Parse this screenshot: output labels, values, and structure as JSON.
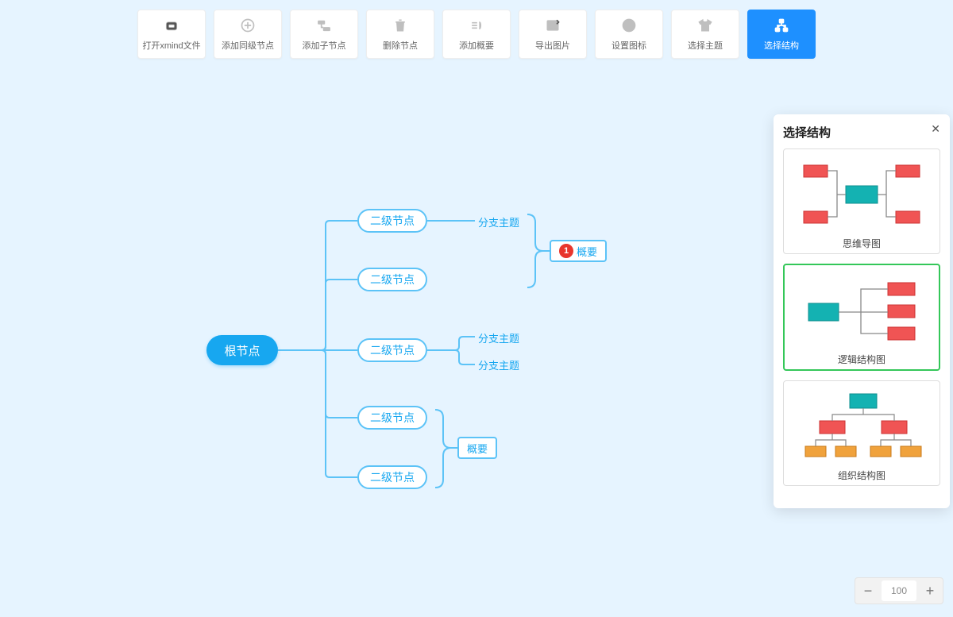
{
  "toolbar": {
    "buttons": [
      {
        "id": "open-xmind",
        "label": "打开xmind文件",
        "icon": "open"
      },
      {
        "id": "add-sibling",
        "label": "添加同级节点",
        "icon": "plus"
      },
      {
        "id": "add-child",
        "label": "添加子节点",
        "icon": "child"
      },
      {
        "id": "delete-node",
        "label": "删除节点",
        "icon": "trash"
      },
      {
        "id": "add-summary",
        "label": "添加概要",
        "icon": "summary"
      },
      {
        "id": "export-image",
        "label": "导出图片",
        "icon": "image"
      },
      {
        "id": "set-icon",
        "label": "设置图标",
        "icon": "smile"
      },
      {
        "id": "choose-theme",
        "label": "选择主题",
        "icon": "shirt"
      },
      {
        "id": "choose-structure",
        "label": "选择结构",
        "icon": "structure",
        "active": true
      }
    ]
  },
  "map": {
    "root": "根节点",
    "level2": "二级节点",
    "branch": "分支主题",
    "summary": "概要",
    "summary_badge": "1"
  },
  "panel": {
    "title": "选择结构",
    "options": [
      {
        "id": "mindmap",
        "label": "思维导图"
      },
      {
        "id": "logic",
        "label": "逻辑结构图",
        "selected": true
      },
      {
        "id": "org",
        "label": "组织结构图"
      }
    ]
  },
  "zoom": {
    "value": "100"
  },
  "colors": {
    "accent": "#17a7f0",
    "node_border": "#5cc3f7",
    "red": "#f05454",
    "teal": "#1aa6a6",
    "orange": "#f0a23c"
  }
}
